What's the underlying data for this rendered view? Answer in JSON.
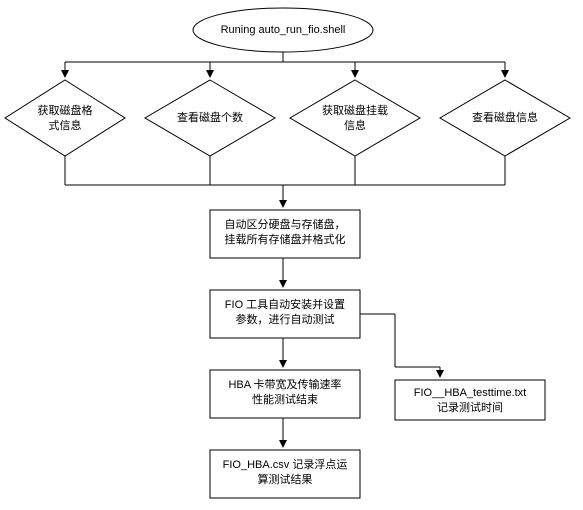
{
  "chart_data": {
    "type": "flowchart",
    "nodes": [
      {
        "id": "start",
        "shape": "ellipse",
        "text": "Runing auto_run_fio.shell"
      },
      {
        "id": "d1",
        "shape": "diamond",
        "text": "获取磁盘格\n式信息"
      },
      {
        "id": "d2",
        "shape": "diamond",
        "text": "查看磁盘个数"
      },
      {
        "id": "d3",
        "shape": "diamond",
        "text": "获取磁盘挂载\n信息"
      },
      {
        "id": "d4",
        "shape": "diamond",
        "text": "查看磁盘信息"
      },
      {
        "id": "p1",
        "shape": "rect",
        "text": "自动区分硬盘与存储盘，\n挂载所有存储盘并格式化"
      },
      {
        "id": "p2",
        "shape": "rect",
        "text": "FIO 工具自动安装并设置\n参数，进行自动测试"
      },
      {
        "id": "p3",
        "shape": "rect",
        "text": "HBA 卡带宽及传输速率\n性能测试结束"
      },
      {
        "id": "p4",
        "shape": "rect",
        "text": "FIO__HBA_testtime.txt\n记录测试时间"
      },
      {
        "id": "p5",
        "shape": "rect",
        "text": "FIO_HBA.csv 记录浮点运\n算测试结果"
      }
    ],
    "edges": [
      [
        "start",
        "d1"
      ],
      [
        "start",
        "d2"
      ],
      [
        "start",
        "d3"
      ],
      [
        "start",
        "d4"
      ],
      [
        "d1",
        "p1"
      ],
      [
        "d2",
        "p1"
      ],
      [
        "d3",
        "p1"
      ],
      [
        "d4",
        "p1"
      ],
      [
        "p1",
        "p2"
      ],
      [
        "p2",
        "p3"
      ],
      [
        "p2",
        "p4"
      ],
      [
        "p3",
        "p5"
      ]
    ]
  },
  "labels": {
    "start": "Runing auto_run_fio.shell",
    "d1": "获取磁盘格<br>式信息",
    "d2": "查看磁盘个数",
    "d3": "获取磁盘挂载<br>信息",
    "d4": "查看磁盘信息",
    "p1": "自动区分硬盘与存储盘，<br>挂载所有存储盘并格式化",
    "p2": "FIO 工具自动安装并设置<br>参数，进行自动测试",
    "p3": "HBA 卡带宽及传输速率<br>性能测试结束",
    "p4": "FIO__HBA_testtime.txt<br>记录测试时间",
    "p5": "FIO_HBA.csv 记录浮点运<br>算测试结果"
  }
}
